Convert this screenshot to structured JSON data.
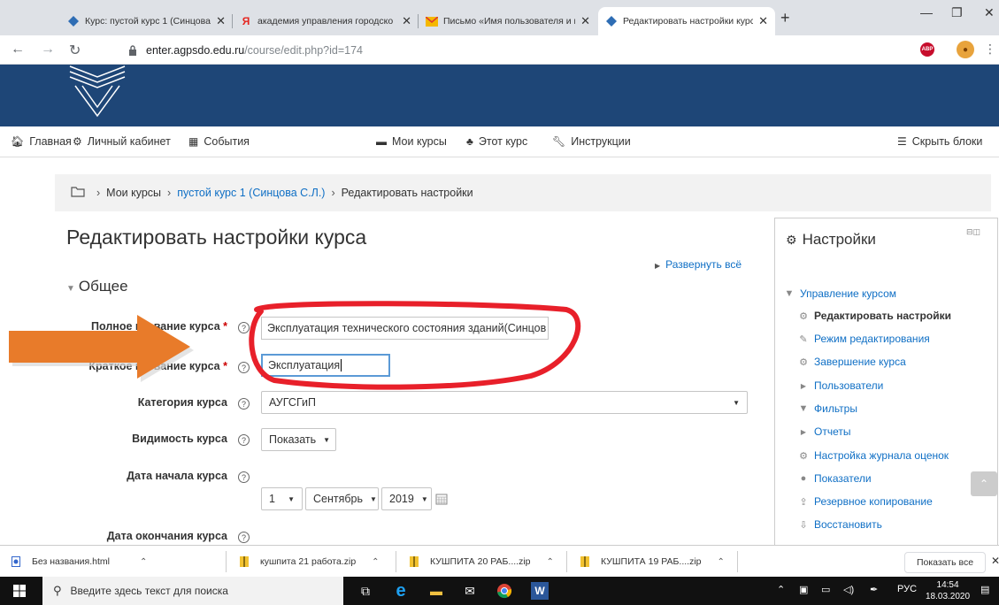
{
  "tabs": [
    {
      "title": "Курс: пустой курс 1 (Синцова С.Л.)",
      "active": false
    },
    {
      "title": "академия управления городско",
      "active": false
    },
    {
      "title": "Письмо «Имя пользователя и п",
      "active": false
    },
    {
      "title": "Редактировать настройки курса",
      "active": true
    }
  ],
  "address": {
    "host": "enter.agpsdo.edu.ru",
    "path": "/course/edit.php?id=174"
  },
  "nav": {
    "home": "Главная",
    "cabinet": "Личный кабинет",
    "events": "События",
    "mycourses": "Мои курсы",
    "thiscourse": "Этот курс",
    "instructions": "Инструкции",
    "hideblocks": "Скрыть блоки"
  },
  "breadcrumb": {
    "mycourses": "Мои курсы",
    "course": "пустой курс 1 (Синцова С.Л.)",
    "current": "Редактировать настройки"
  },
  "page": {
    "title": "Редактировать настройки курса",
    "expand_all": "Развернуть всё",
    "section": "Общее"
  },
  "form": {
    "fullname_label": "Полное название курса",
    "fullname_value": "Эксплуатация технического состояния зданий(Синцов",
    "shortname_label": "Краткое название курса",
    "shortname_value": "Эксплуатация",
    "category_label": "Категория курса",
    "category_value": "АУГСГиП",
    "visibility_label": "Видимость курса",
    "visibility_value": "Показать",
    "startdate_label": "Дата начала курса",
    "start_day": "1",
    "start_month": "Сентябрь",
    "start_year": "2019",
    "enddate_label": "Дата окончания курса",
    "required_mark": "*",
    "help_mark": "?"
  },
  "settings_block": {
    "title": "Настройки",
    "items": [
      {
        "label": "Управление курсом",
        "type": "section"
      },
      {
        "label": "Редактировать настройки",
        "type": "current"
      },
      {
        "label": "Режим редактирования",
        "type": "link"
      },
      {
        "label": "Завершение курса",
        "type": "link"
      },
      {
        "label": "Пользователи",
        "type": "collapsed"
      },
      {
        "label": "Фильтры",
        "type": "link"
      },
      {
        "label": "Отчеты",
        "type": "collapsed"
      },
      {
        "label": "Настройка журнала оценок",
        "type": "link"
      },
      {
        "label": "Показатели",
        "type": "link"
      },
      {
        "label": "Резервное копирование",
        "type": "link"
      },
      {
        "label": "Восстановить",
        "type": "link"
      }
    ]
  },
  "downloads": [
    {
      "name": "Без названия.html"
    },
    {
      "name": "кушпита 21 работа.zip"
    },
    {
      "name": "КУШПИТА 20 РАБ....zip"
    },
    {
      "name": "КУШПИТА 19 РАБ....zip"
    }
  ],
  "show_all": "Показать все",
  "taskbar": {
    "search_placeholder": "Введите здесь текст для поиска",
    "lang": "РУС",
    "time": "14:54",
    "date": "18.03.2020"
  },
  "colors": {
    "header": "#1e4677",
    "link": "#0f6fc5",
    "annotation_red": "#e8202a",
    "arrow_orange": "#e87b2a"
  }
}
